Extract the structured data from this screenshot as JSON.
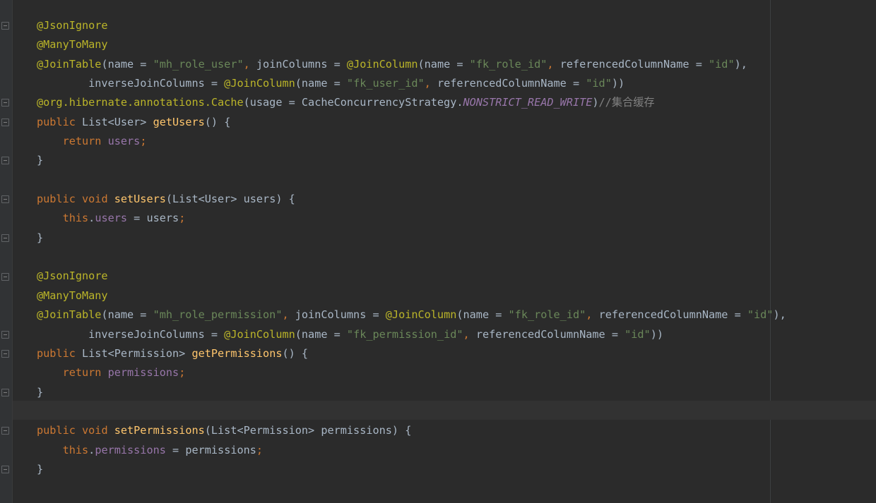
{
  "editor": {
    "lines": [
      [
        {
          "t": "@JsonIgnore",
          "c": "ann"
        }
      ],
      [
        {
          "t": "@ManyToMany",
          "c": "ann"
        }
      ],
      [
        {
          "t": "@JoinTable",
          "c": "ann"
        },
        {
          "t": "(name = ",
          "c": ""
        },
        {
          "t": "\"mh_role_user\"",
          "c": "str"
        },
        {
          "t": ", ",
          "c": "kw"
        },
        {
          "t": "joinColumns = ",
          "c": ""
        },
        {
          "t": "@JoinColumn",
          "c": "ann"
        },
        {
          "t": "(name = ",
          "c": ""
        },
        {
          "t": "\"fk_role_id\"",
          "c": "str"
        },
        {
          "t": ", ",
          "c": "kw"
        },
        {
          "t": "referencedColumnName = ",
          "c": ""
        },
        {
          "t": "\"id\"",
          "c": "str"
        },
        {
          "t": "),",
          "c": ""
        }
      ],
      [
        {
          "t": "        inverseJoinColumns = ",
          "c": ""
        },
        {
          "t": "@JoinColumn",
          "c": "ann"
        },
        {
          "t": "(name = ",
          "c": ""
        },
        {
          "t": "\"fk_user_id\"",
          "c": "str"
        },
        {
          "t": ", ",
          "c": "kw"
        },
        {
          "t": "referencedColumnName = ",
          "c": ""
        },
        {
          "t": "\"id\"",
          "c": "str"
        },
        {
          "t": "))",
          "c": ""
        }
      ],
      [
        {
          "t": "@org.hibernate.annotations.",
          "c": "ann"
        },
        {
          "t": "Cache",
          "c": "ann"
        },
        {
          "t": "(usage = CacheConcurrencyStrategy.",
          "c": ""
        },
        {
          "t": "NONSTRICT_READ_WRITE",
          "c": "cst"
        },
        {
          "t": ")",
          "c": ""
        },
        {
          "t": "//集合缓存",
          "c": "cmt"
        }
      ],
      [
        {
          "t": "public ",
          "c": "kw"
        },
        {
          "t": "List<User> ",
          "c": ""
        },
        {
          "t": "getUsers",
          "c": "fn"
        },
        {
          "t": "() {",
          "c": ""
        }
      ],
      [
        {
          "t": "    ",
          "c": ""
        },
        {
          "t": "return ",
          "c": "kw"
        },
        {
          "t": "users",
          "c": "fld"
        },
        {
          "t": ";",
          "c": "kw"
        }
      ],
      [
        {
          "t": "}",
          "c": ""
        }
      ],
      [
        {
          "t": "",
          "c": ""
        }
      ],
      [
        {
          "t": "public ",
          "c": "kw"
        },
        {
          "t": "void ",
          "c": "kw"
        },
        {
          "t": "setUsers",
          "c": "fn"
        },
        {
          "t": "(List<User> users) {",
          "c": ""
        }
      ],
      [
        {
          "t": "    ",
          "c": ""
        },
        {
          "t": "this",
          "c": "kw"
        },
        {
          "t": ".",
          "c": ""
        },
        {
          "t": "users",
          "c": "fld"
        },
        {
          "t": " = users",
          "c": ""
        },
        {
          "t": ";",
          "c": "kw"
        }
      ],
      [
        {
          "t": "}",
          "c": ""
        }
      ],
      [
        {
          "t": "",
          "c": ""
        }
      ],
      [
        {
          "t": "@JsonIgnore",
          "c": "ann"
        }
      ],
      [
        {
          "t": "@ManyToMany",
          "c": "ann"
        }
      ],
      [
        {
          "t": "@JoinTable",
          "c": "ann"
        },
        {
          "t": "(name = ",
          "c": ""
        },
        {
          "t": "\"mh_role_permission\"",
          "c": "str"
        },
        {
          "t": ", ",
          "c": "kw"
        },
        {
          "t": "joinColumns = ",
          "c": ""
        },
        {
          "t": "@JoinColumn",
          "c": "ann"
        },
        {
          "t": "(name = ",
          "c": ""
        },
        {
          "t": "\"fk_role_id\"",
          "c": "str"
        },
        {
          "t": ", ",
          "c": "kw"
        },
        {
          "t": "referencedColumnName = ",
          "c": ""
        },
        {
          "t": "\"id\"",
          "c": "str"
        },
        {
          "t": "),",
          "c": ""
        }
      ],
      [
        {
          "t": "        inverseJoinColumns = ",
          "c": ""
        },
        {
          "t": "@JoinColumn",
          "c": "ann"
        },
        {
          "t": "(name = ",
          "c": ""
        },
        {
          "t": "\"fk_permission_id\"",
          "c": "str"
        },
        {
          "t": ", ",
          "c": "kw"
        },
        {
          "t": "referencedColumnName = ",
          "c": ""
        },
        {
          "t": "\"id\"",
          "c": "str"
        },
        {
          "t": "))",
          "c": ""
        }
      ],
      [
        {
          "t": "public ",
          "c": "kw"
        },
        {
          "t": "List<Permission> ",
          "c": ""
        },
        {
          "t": "getPermissions",
          "c": "fn"
        },
        {
          "t": "() {",
          "c": ""
        }
      ],
      [
        {
          "t": "    ",
          "c": ""
        },
        {
          "t": "return ",
          "c": "kw"
        },
        {
          "t": "permissions",
          "c": "fld"
        },
        {
          "t": ";",
          "c": "kw"
        }
      ],
      [
        {
          "t": "}",
          "c": ""
        }
      ],
      [
        {
          "t": "",
          "c": ""
        }
      ],
      [
        {
          "t": "public ",
          "c": "kw"
        },
        {
          "t": "void ",
          "c": "kw"
        },
        {
          "t": "setPermissions",
          "c": "fn"
        },
        {
          "t": "(List<Permission> permissions) {",
          "c": ""
        }
      ],
      [
        {
          "t": "    ",
          "c": ""
        },
        {
          "t": "this",
          "c": "kw"
        },
        {
          "t": ".",
          "c": ""
        },
        {
          "t": "permissions",
          "c": "fld"
        },
        {
          "t": " = permissions",
          "c": ""
        },
        {
          "t": ";",
          "c": "kw"
        }
      ],
      [
        {
          "t": "}",
          "c": ""
        }
      ]
    ],
    "fold_markers": [
      0,
      4,
      5,
      7,
      9,
      11,
      13,
      16,
      17,
      19,
      21,
      23
    ]
  }
}
